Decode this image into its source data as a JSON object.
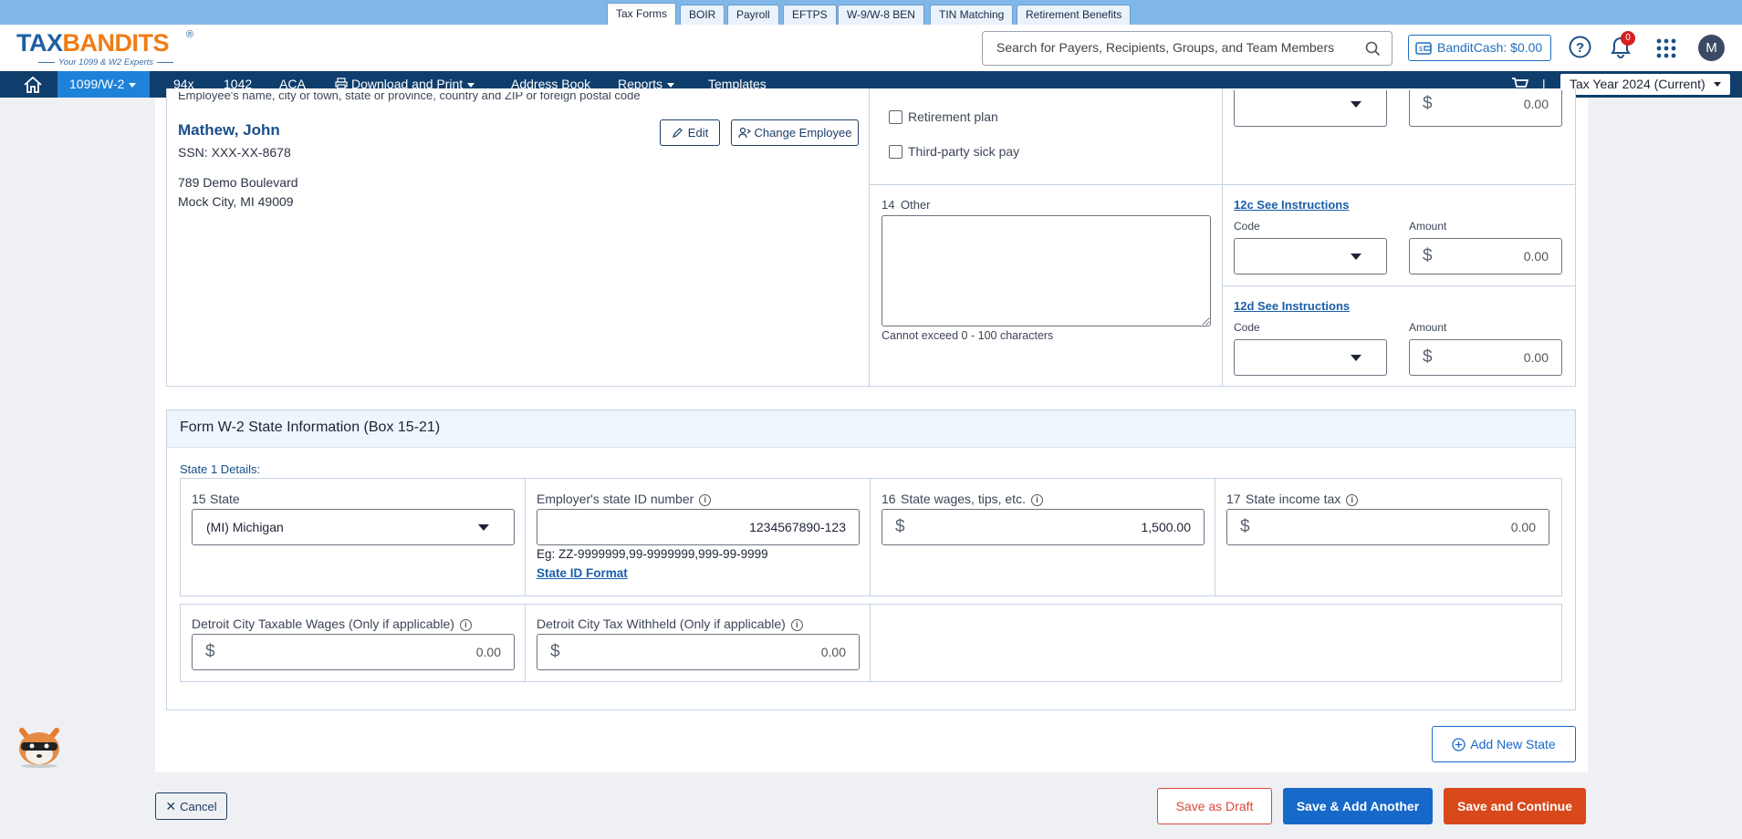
{
  "top_tabs": [
    "Tax Forms",
    "BOIR",
    "Payroll",
    "EFTPS",
    "W-9/W-8 BEN",
    "TIN Matching",
    "Retirement Benefits"
  ],
  "logo": {
    "text_a": "TAX",
    "text_b": "BANDITS",
    "tagline": "Your 1099 & W2 Experts",
    "reg": "®"
  },
  "search": {
    "placeholder": "Search for Payers, Recipients, Groups, and Team Members"
  },
  "bandit_cash": "BanditCash: $0.00",
  "notification_count": "0",
  "avatar_initial": "M",
  "nav": {
    "items": [
      "1099/W-2",
      "94x",
      "1042",
      "ACA",
      "Download and Print",
      "Address Book",
      "Reports",
      "Templates"
    ],
    "separator": "|",
    "tax_year": "Tax Year 2024 (Current)"
  },
  "employee": {
    "cut_label": "Employee's name, city or town, state or province, country and ZIP or foreign postal code",
    "name": "Mathew, John",
    "ssn": "SSN: XXX-XX-8678",
    "address1": "789 Demo Boulevard",
    "address2": "Mock City, MI 49009",
    "edit_label": "Edit",
    "change_label": "Change Employee"
  },
  "box13": {
    "retirement": "Retirement plan",
    "sick_pay": "Third-party sick pay"
  },
  "box14": {
    "num": "14",
    "label": "Other",
    "value": "",
    "hint": "Cannot exceed 0 - 100 characters"
  },
  "box12": {
    "top_amount": "0.00",
    "c": {
      "link": "12c See Instructions",
      "code_label": "Code",
      "amount_label": "Amount",
      "amount": "0.00"
    },
    "d": {
      "link": "12d See Instructions",
      "code_label": "Code",
      "amount_label": "Amount",
      "amount": "0.00"
    }
  },
  "state_section": {
    "title": "Form W-2 State Information (Box 15-21)",
    "sub": "State 1 Details:",
    "box15": {
      "num": "15",
      "label": "State",
      "value": "(MI) Michigan"
    },
    "employer_id": {
      "label": "Employer's state ID number",
      "value": "1234567890-123",
      "eg": "Eg: ZZ-9999999,99-9999999,999-99-9999",
      "link": "State ID Format"
    },
    "box16": {
      "num": "16",
      "label": "State wages, tips, etc.",
      "value": "1,500.00"
    },
    "box17": {
      "num": "17",
      "label": "State income tax",
      "value": "0.00"
    },
    "detroit_wages": {
      "label": "Detroit City Taxable Wages (Only if applicable)",
      "value": "0.00"
    },
    "detroit_tax": {
      "label": "Detroit City Tax Withheld (Only if applicable)",
      "value": "0.00"
    },
    "add_state": "Add New State"
  },
  "footer": {
    "cancel": "Cancel",
    "draft": "Save as Draft",
    "add_another": "Save & Add Another",
    "continue": "Save and Continue"
  },
  "colors": {
    "brand": "#1f5fa3",
    "accent": "#f07c16",
    "nav": "#0f3e6c",
    "primary": "#1769c9",
    "danger": "#d8481a"
  }
}
